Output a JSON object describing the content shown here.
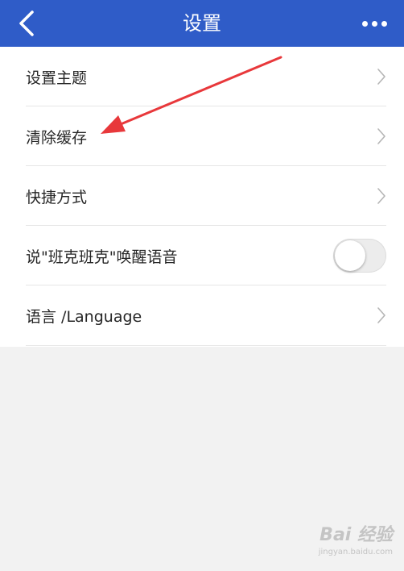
{
  "header": {
    "title": "设置",
    "back_icon": "chevron-left-icon",
    "more_icon": "more-horizontal-icon"
  },
  "settings": [
    {
      "label": "设置主题",
      "control": "chevron"
    },
    {
      "label": "清除缓存",
      "control": "chevron"
    },
    {
      "label": "快捷方式",
      "control": "chevron"
    },
    {
      "label": "说\"班克班克\"唤醒语音",
      "control": "toggle",
      "toggle_on": false
    },
    {
      "label": "语言 /Language",
      "control": "chevron"
    }
  ],
  "annotation": {
    "color": "#e8383b",
    "points_to": "清除缓存"
  },
  "watermark": {
    "text": "Bai 经验",
    "sub": "jingyan.baidu.com"
  },
  "colors": {
    "header_bg": "#2f5cc8",
    "page_bg": "#f2f2f2",
    "row_bg": "#ffffff",
    "divider": "#e6e6e6",
    "toggle_off": "#ececec"
  }
}
